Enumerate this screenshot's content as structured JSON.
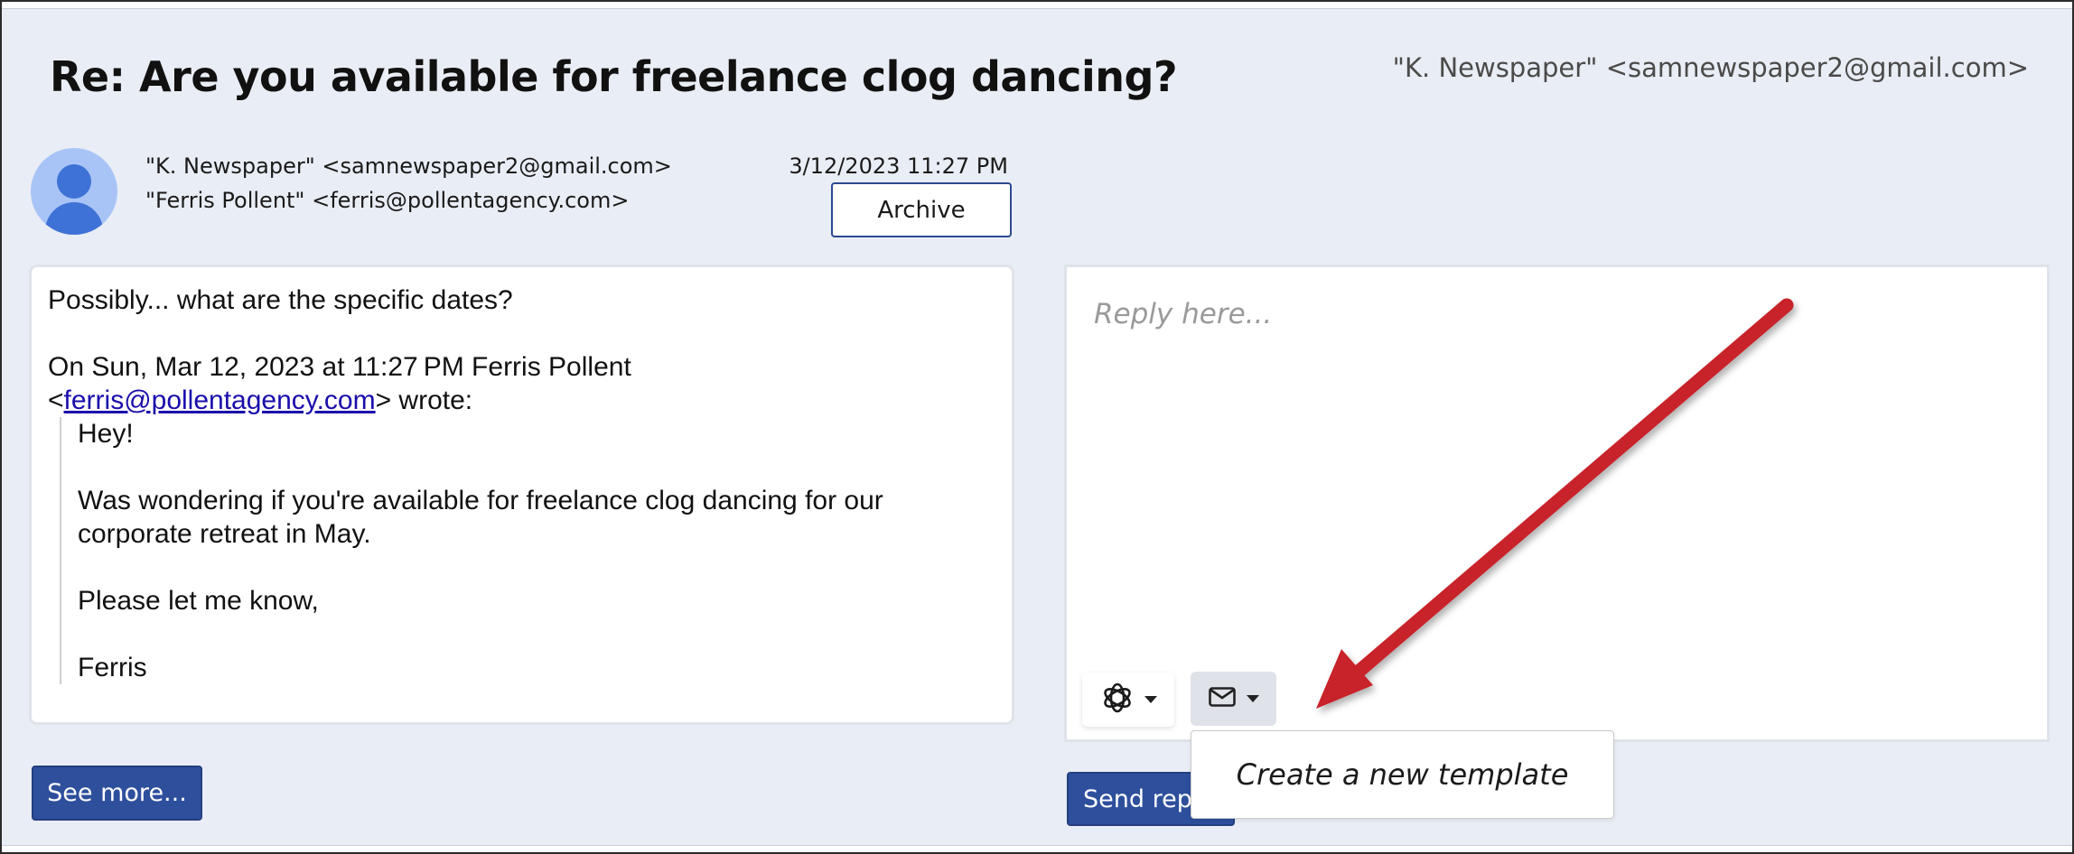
{
  "header": {
    "subject": "Re: Are you available for freelance clog dancing?",
    "account": "\"K. Newspaper\" <samnewspaper2@gmail.com>"
  },
  "message_meta": {
    "from": "\"K. Newspaper\" <samnewspaper2@gmail.com>",
    "to": "\"Ferris Pollent\" <ferris@pollentagency.com>",
    "date": "3/12/2023 11:27 PM",
    "archive_label": "Archive"
  },
  "message": {
    "reply_text": "Possibly... what are the specific dates?",
    "attribution_prefix": "On Sun, Mar 12, 2023 at 11:27 PM Ferris Pollent",
    "attribution_open": "<",
    "attribution_email": "ferris@pollentagency.com",
    "attribution_suffix": "> wrote:",
    "quoted": {
      "greeting": "Hey!",
      "body": "Was wondering if you're available for freelance clog dancing for our corporate retreat in May.",
      "closing": "Please let me know,",
      "signature": "Ferris"
    }
  },
  "see_more_label": "See more...",
  "reply": {
    "placeholder": "Reply here...",
    "send_label": "Send reply"
  },
  "toolbar": {
    "ai_icon": "openai-icon",
    "template_icon": "envelope-icon"
  },
  "template_menu": {
    "items": [
      "Create a new template"
    ]
  },
  "annotation": {
    "arrow_color": "#c8242b"
  }
}
